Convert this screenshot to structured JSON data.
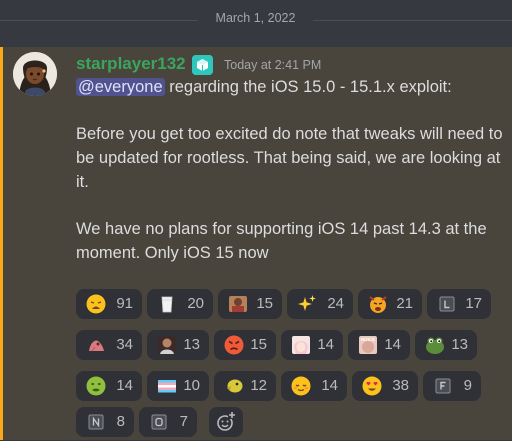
{
  "divider": {
    "date": "March 1, 2022"
  },
  "message": {
    "username": "starplayer132",
    "timestamp": "Today at 2:41 PM",
    "mention": "@everyone",
    "line1_rest": " regarding the iOS 15.0 - 15.1.x exploit:",
    "paragraph2": "Before you get too excited do note that tweaks will need to be updated for rootless. That being said, we are looking at it.",
    "paragraph3": "We have no plans for supporting iOS 14 past 14.3 at the moment. Only iOS 15 now"
  },
  "reactions": [
    {
      "emoji": "weary-face",
      "count": "91"
    },
    {
      "emoji": "glass-of-milk",
      "count": "20"
    },
    {
      "emoji": "custom-emote-photo",
      "count": "15"
    },
    {
      "emoji": "sparkles",
      "count": "24"
    },
    {
      "emoji": "custom-emote-angry-face",
      "count": "21"
    },
    {
      "emoji": "letter-l-tile",
      "count": "17"
    },
    {
      "emoji": "custom-emote-pink",
      "count": "34"
    },
    {
      "emoji": "custom-emote-photo",
      "count": "13"
    },
    {
      "emoji": "angry-face",
      "count": "15"
    },
    {
      "emoji": "custom-emote-anime",
      "count": "14"
    },
    {
      "emoji": "custom-emote-noice",
      "count": "14",
      "overlay_text": "NOICE"
    },
    {
      "emoji": "frog-emote",
      "count": "13"
    },
    {
      "emoji": "nauseated-face",
      "count": "14"
    },
    {
      "emoji": "transgender-flag",
      "count": "10"
    },
    {
      "emoji": "custom-emote-yellow",
      "count": "12"
    },
    {
      "emoji": "relieved-face",
      "count": "14"
    },
    {
      "emoji": "heart-eyes-face",
      "count": "38"
    },
    {
      "emoji": "letter-f-tile",
      "count": "9"
    },
    {
      "emoji": "letter-n-tile",
      "count": "8"
    },
    {
      "emoji": "letter-o-tile",
      "count": "7"
    }
  ],
  "colors": {
    "background": "#36393f",
    "highlight": "#49443c",
    "accent": "#faa81a",
    "username": "#3ba55d",
    "mention_bg": "#5865f2",
    "reaction_bg": "#2f3136"
  }
}
